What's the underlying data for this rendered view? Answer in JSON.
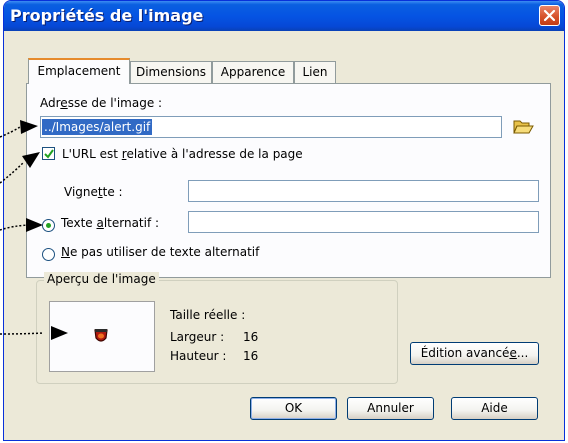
{
  "window": {
    "title": "Propriétés de l'image"
  },
  "icons": {
    "close": "close-icon",
    "folder": "open-folder-icon",
    "preview": "alert-icon"
  },
  "tabs": [
    {
      "label": "Emplacement",
      "active": true
    },
    {
      "label": "Dimensions",
      "active": false
    },
    {
      "label": "Apparence",
      "active": false
    },
    {
      "label": "Lien",
      "active": false
    }
  ],
  "location": {
    "address_pre": "Adr",
    "address_u": "e",
    "address_post": "sse de l'image :",
    "address_value": "../Images/alert.gif",
    "relative_pre": "L'URL est ",
    "relative_u": "r",
    "relative_post": "elative à l'adresse de la page",
    "relative_checked": true,
    "vignette_pre": "Vigne",
    "vignette_u": "t",
    "vignette_post": "te :",
    "vignette_value": "",
    "alt_pre": "Texte ",
    "alt_u": "a",
    "alt_post": "lternatif :",
    "alt_selected": true,
    "alt_value": "",
    "noalt_u": "N",
    "noalt_post": "e pas utiliser de texte alternatif",
    "noalt_selected": false
  },
  "preview": {
    "legend": "Aperçu de l'image",
    "real_size": "Taille réelle :",
    "width_label": "Largeur :",
    "width_value": "16",
    "height_label": "Hauteur :",
    "height_value": "16"
  },
  "buttons": {
    "advanced_pre": "Édition avancé",
    "advanced_u": "e",
    "advanced_post": "...",
    "ok": "OK",
    "cancel": "Annuler",
    "help": "Aide"
  },
  "colors": {
    "titlebar": "#0554e3",
    "selection": "#316ac5",
    "tab_highlight": "#e68b2c"
  }
}
